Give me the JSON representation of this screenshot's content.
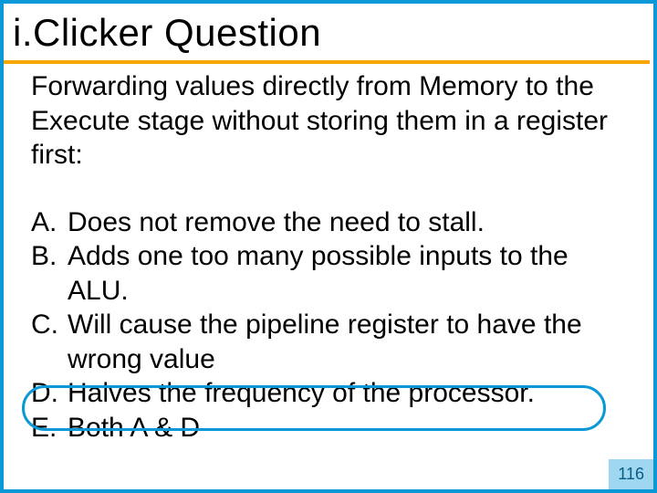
{
  "title": "i.Clicker Question",
  "question": "Forwarding values directly from Memory to the Execute stage without storing them in a register first:",
  "answers": {
    "A": {
      "letter": "A.",
      "text": "Does not remove the need to stall."
    },
    "B": {
      "letter": "B.",
      "text": "Adds one too many possible inputs to the ALU."
    },
    "C": {
      "letter": "C.",
      "text": "Will cause the pipeline register to have the wrong value"
    },
    "D": {
      "letter": "D.",
      "text": "Halves the frequency of the processor."
    },
    "E": {
      "letter": "E.",
      "text": "Both A & D"
    }
  },
  "highlighted": "D",
  "page_number": "116"
}
